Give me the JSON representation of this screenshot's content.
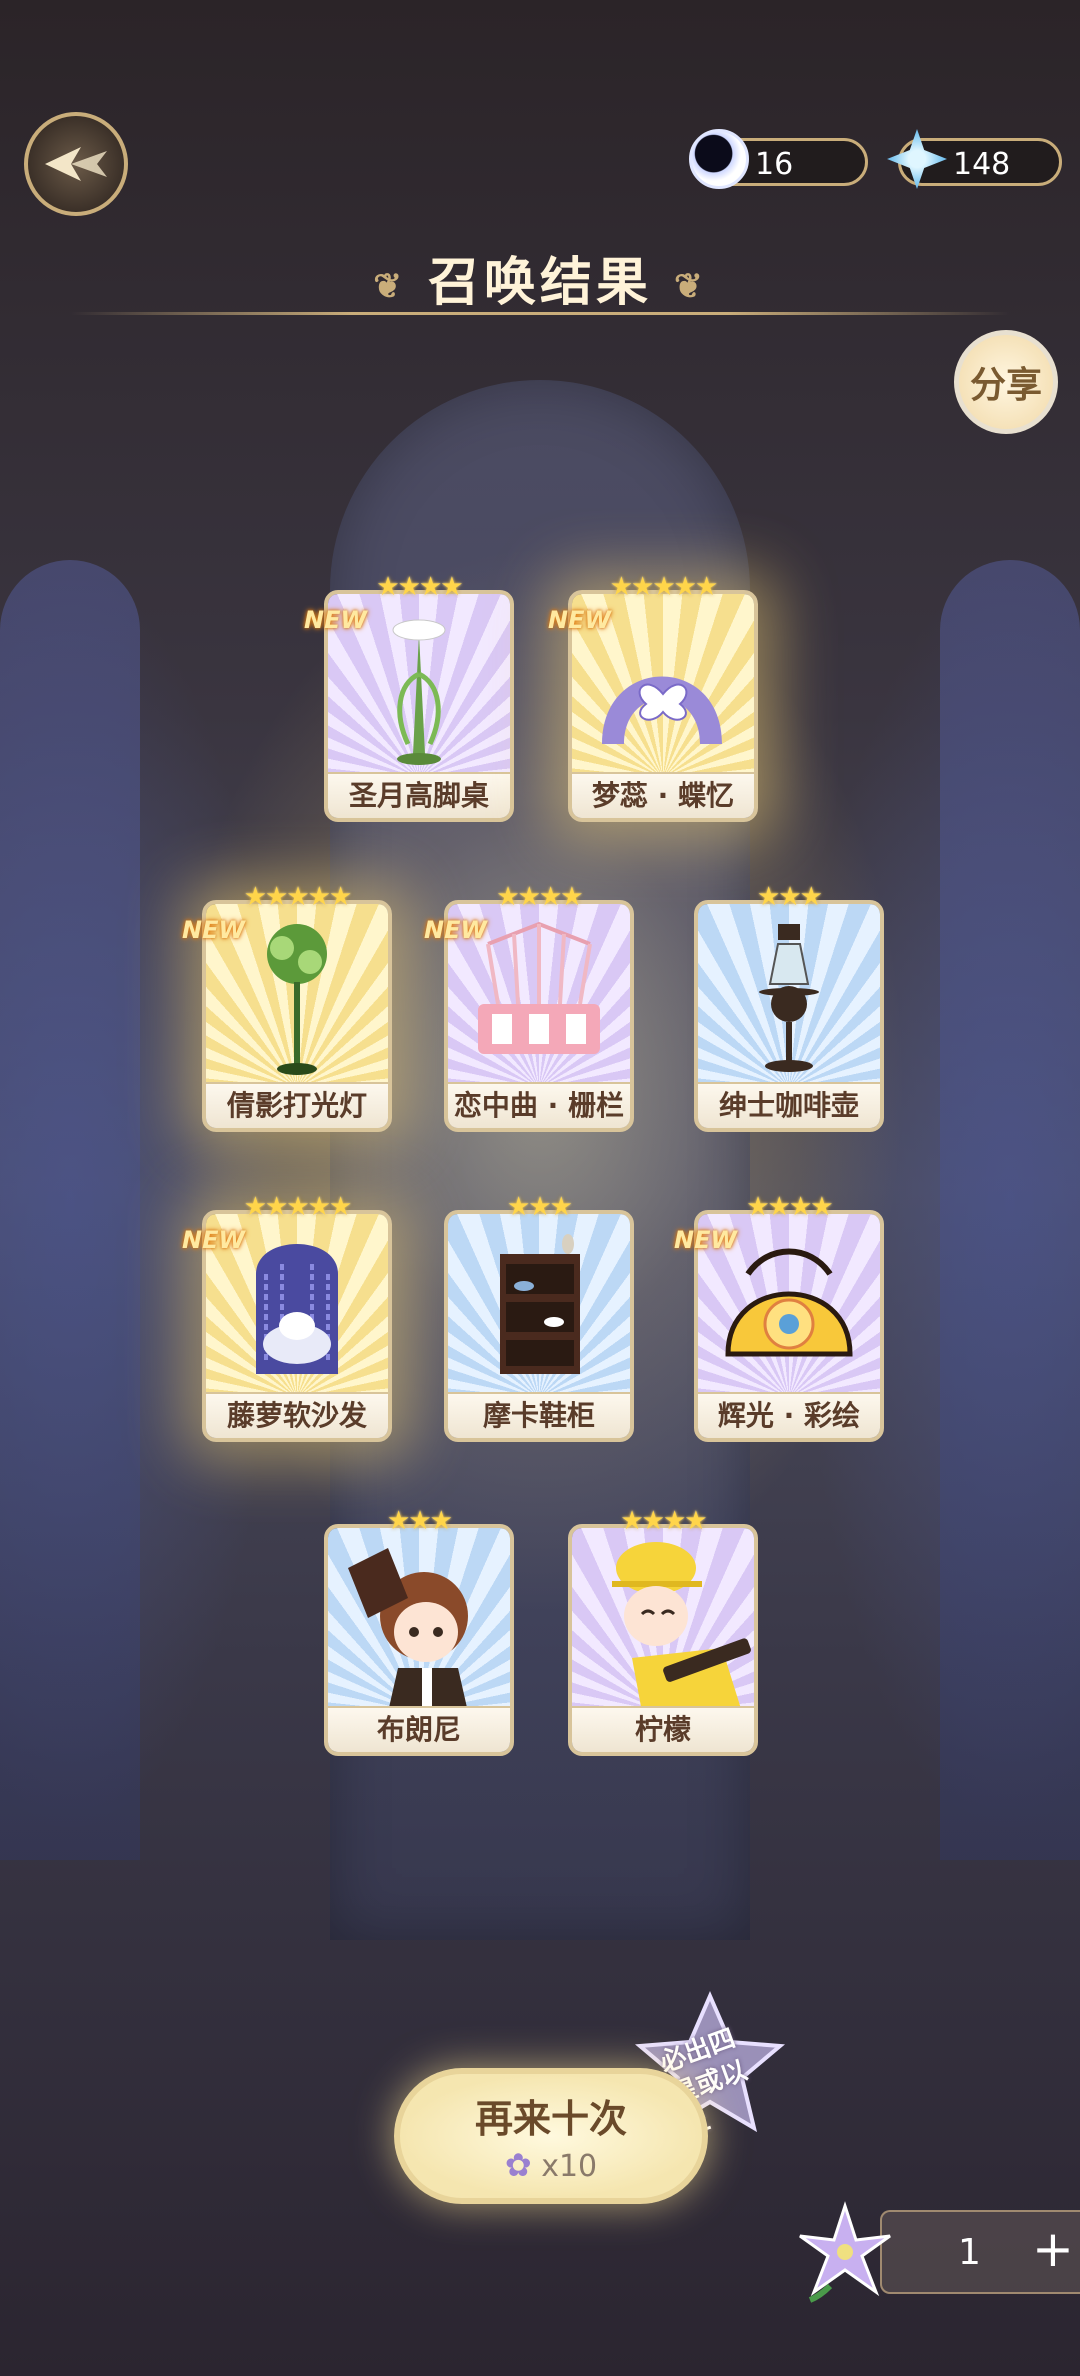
{
  "header": {
    "title": "召唤结果",
    "share_label": "分享",
    "currencies": [
      {
        "icon": "moon-icon",
        "value": "16"
      },
      {
        "icon": "crystal-icon",
        "value": "148"
      }
    ]
  },
  "cards": [
    {
      "name": "圣月高脚桌",
      "stars": "★★★★",
      "new": "NEW",
      "rarity": "purple"
    },
    {
      "name": "梦蕊 · 蝶忆",
      "stars": "★★★★★",
      "new": "NEW",
      "rarity": "gold"
    },
    {
      "name": "倩影打光灯",
      "stars": "★★★★★",
      "new": "NEW",
      "rarity": "gold"
    },
    {
      "name": "恋中曲 · 栅栏",
      "stars": "★★★★",
      "new": "NEW",
      "rarity": "purple"
    },
    {
      "name": "绅士咖啡壶",
      "stars": "★★★",
      "new": "",
      "rarity": "blue"
    },
    {
      "name": "藤萝软沙发",
      "stars": "★★★★★",
      "new": "NEW",
      "rarity": "gold"
    },
    {
      "name": "摩卡鞋柜",
      "stars": "★★★",
      "new": "",
      "rarity": "blue"
    },
    {
      "name": "辉光 · 彩绘",
      "stars": "★★★★",
      "new": "NEW",
      "rarity": "purple"
    },
    {
      "name": "布朗尼",
      "stars": "★★★",
      "new": "",
      "rarity": "blue"
    },
    {
      "name": "柠檬",
      "stars": "★★★★",
      "new": "",
      "rarity": "purple"
    }
  ],
  "summon_again": {
    "label": "再来十次",
    "cost": "x10",
    "badge": "必出四星或以上"
  },
  "counter": {
    "value": "1",
    "plus": "+"
  }
}
